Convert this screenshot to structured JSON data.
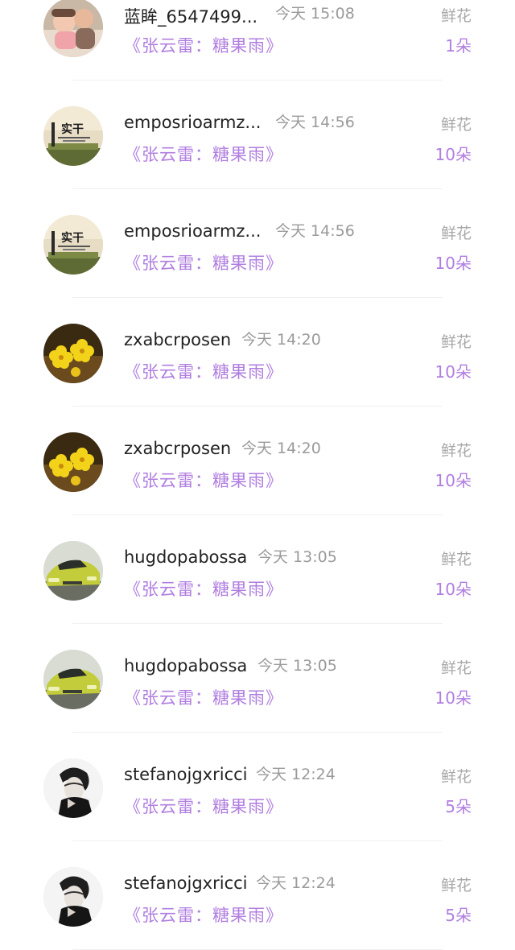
{
  "records": [
    {
      "user": "蓝眸_6547499...",
      "time": "今天 15:08",
      "song": "《张云雷：糖果雨》",
      "gift": "鲜花",
      "count": "1朵",
      "avatar_icon": "baby-photo-avatar"
    },
    {
      "user": "emposrioarmz...",
      "time": "今天 14:56",
      "song": "《张云雷：糖果雨》",
      "gift": "鲜花",
      "count": "10朵",
      "avatar_icon": "shigan-text-avatar"
    },
    {
      "user": "emposrioarmz...",
      "time": "今天 14:56",
      "song": "《张云雷：糖果雨》",
      "gift": "鲜花",
      "count": "10朵",
      "avatar_icon": "shigan-text-avatar"
    },
    {
      "user": "zxabcrposen",
      "time": "今天 14:20",
      "song": "《张云雷：糖果雨》",
      "gift": "鲜花",
      "count": "10朵",
      "avatar_icon": "yellow-flower-avatar"
    },
    {
      "user": "zxabcrposen",
      "time": "今天 14:20",
      "song": "《张云雷：糖果雨》",
      "gift": "鲜花",
      "count": "10朵",
      "avatar_icon": "yellow-flower-avatar"
    },
    {
      "user": "hugdopabossa",
      "time": "今天 13:05",
      "song": "《张云雷：糖果雨》",
      "gift": "鲜花",
      "count": "10朵",
      "avatar_icon": "green-car-avatar"
    },
    {
      "user": "hugdopabossa",
      "time": "今天 13:05",
      "song": "《张云雷：糖果雨》",
      "gift": "鲜花",
      "count": "10朵",
      "avatar_icon": "green-car-avatar"
    },
    {
      "user": "stefanojgxricci",
      "time": "今天 12:24",
      "song": "《张云雷：糖果雨》",
      "gift": "鲜花",
      "count": "5朵",
      "avatar_icon": "portrait-sketch-avatar"
    },
    {
      "user": "stefanojgxricci",
      "time": "今天 12:24",
      "song": "《张云雷：糖果雨》",
      "gift": "鲜花",
      "count": "5朵",
      "avatar_icon": "portrait-sketch-avatar"
    }
  ],
  "avatar_text": {
    "shigan": "实干"
  },
  "colors": {
    "song_accent": "#b07ee0",
    "name": "#222222",
    "muted": "#9a9a9a"
  }
}
